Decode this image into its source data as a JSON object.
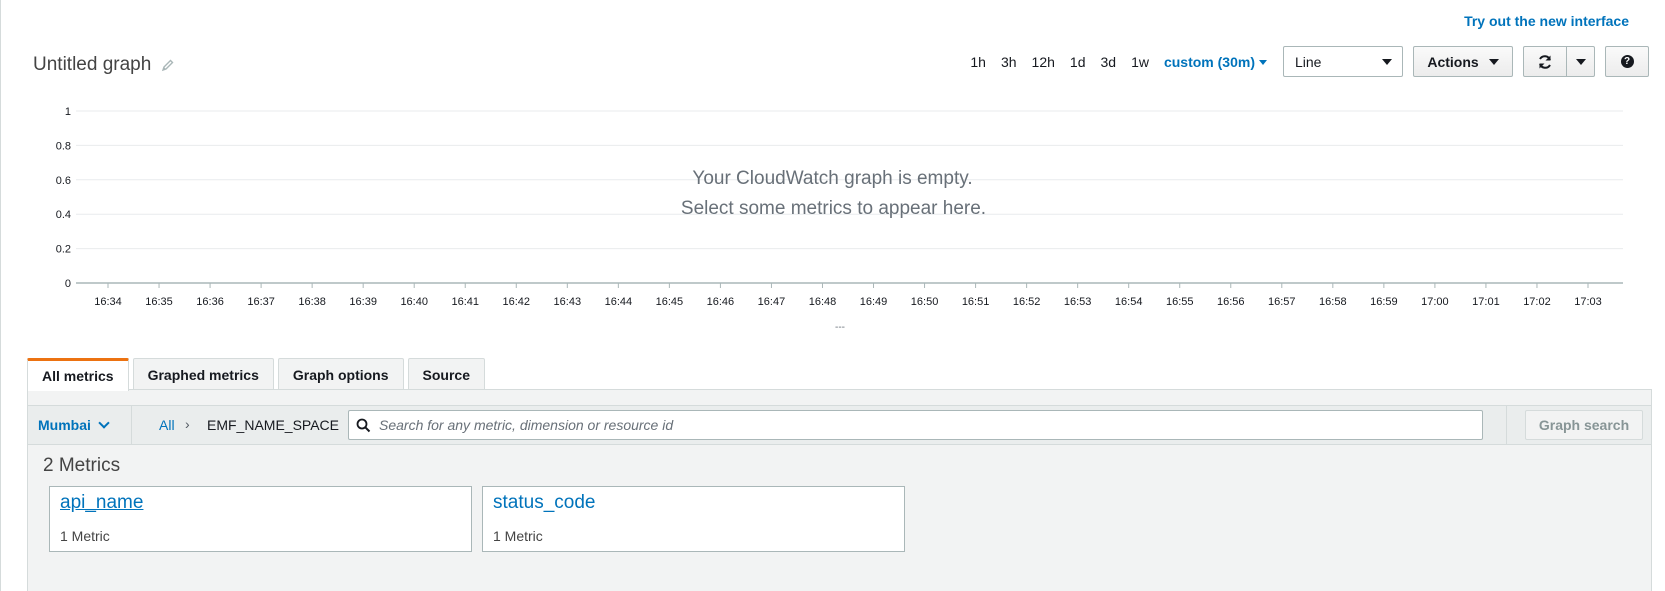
{
  "header": {
    "try_new_label": "Try out the new interface",
    "graph_title": "Untitled graph"
  },
  "toolbar": {
    "ranges": [
      "1h",
      "3h",
      "12h",
      "1d",
      "3d",
      "1w"
    ],
    "custom_range_label": "custom (30m)",
    "chart_type_selected": "Line",
    "actions_label": "Actions"
  },
  "empty_state": {
    "line1": "Your CloudWatch graph is empty.",
    "line2": "Select some metrics to appear here."
  },
  "chart_data": {
    "type": "line",
    "title": "",
    "xlabel": "---",
    "ylabel": "",
    "ylim": [
      0,
      1
    ],
    "y_ticks": [
      "1",
      "0.8",
      "0.6",
      "0.4",
      "0.2",
      "0"
    ],
    "x_ticks": [
      "16:34",
      "16:35",
      "16:36",
      "16:37",
      "16:38",
      "16:39",
      "16:40",
      "16:41",
      "16:42",
      "16:43",
      "16:44",
      "16:45",
      "16:46",
      "16:47",
      "16:48",
      "16:49",
      "16:50",
      "16:51",
      "16:52",
      "16:53",
      "16:54",
      "16:55",
      "16:56",
      "16:57",
      "16:58",
      "16:59",
      "17:00",
      "17:01",
      "17:02",
      "17:03"
    ],
    "grid": true,
    "series": []
  },
  "tabs": [
    {
      "label": "All metrics",
      "active": true
    },
    {
      "label": "Graphed metrics",
      "active": false
    },
    {
      "label": "Graph options",
      "active": false
    },
    {
      "label": "Source",
      "active": false
    }
  ],
  "browser": {
    "region": "Mumbai",
    "breadcrumb_all": "All",
    "breadcrumb_namespace": "EMF_NAME_SPACE",
    "search_placeholder": "Search for any metric, dimension or resource id",
    "graph_search_label": "Graph search",
    "metrics_count": "2 Metrics",
    "cards": [
      {
        "title": "api_name",
        "subtitle": "1 Metric"
      },
      {
        "title": "status_code",
        "subtitle": "1 Metric"
      }
    ]
  },
  "colors": {
    "link": "#0073bb",
    "active_tab_accent": "#ec7211",
    "grid": "#e9ebed"
  }
}
